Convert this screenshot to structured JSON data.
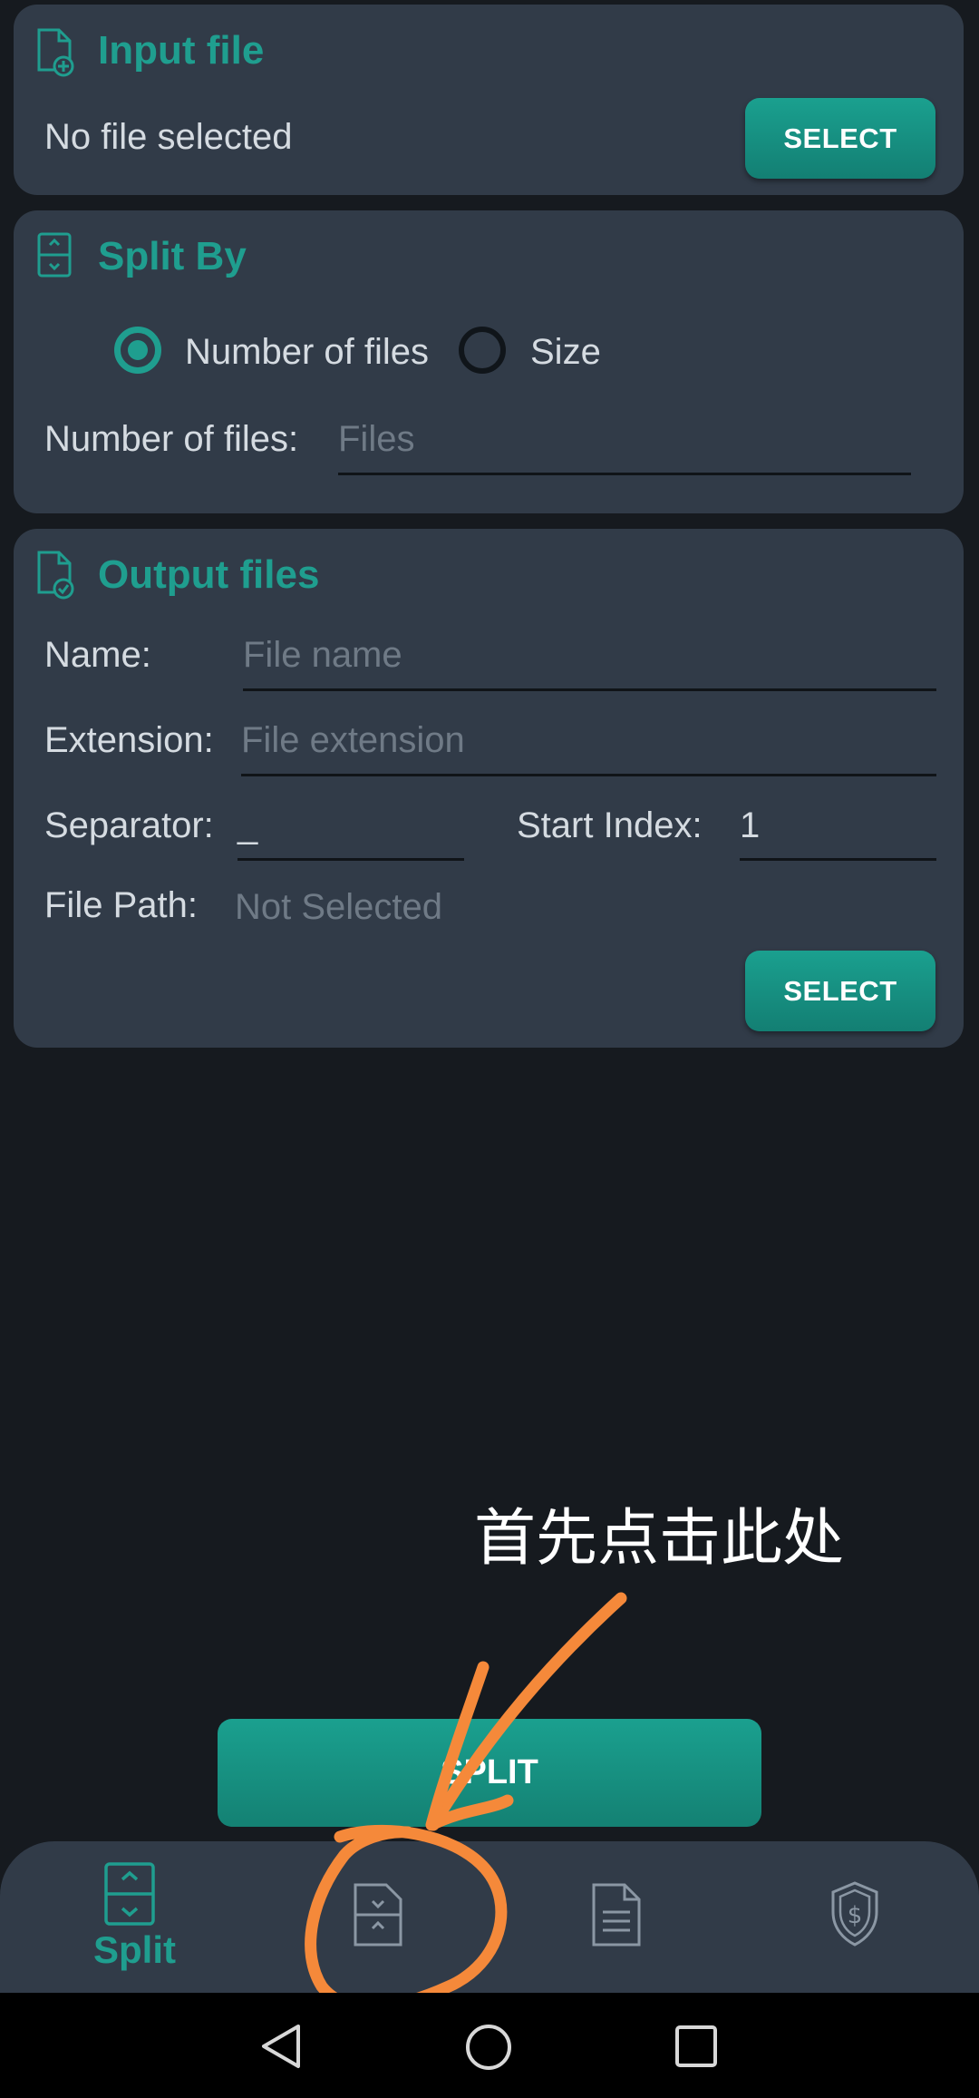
{
  "input_card": {
    "title": "Input file",
    "status": "No file selected",
    "select_label": "SELECT"
  },
  "split_card": {
    "title": "Split By",
    "options": [
      "Number of files",
      "Size"
    ],
    "selected": "Number of files",
    "number_label": "Number of files:",
    "number_placeholder": "Files"
  },
  "output_card": {
    "title": "Output files",
    "name_label": "Name:",
    "name_placeholder": "File name",
    "ext_label": "Extension:",
    "ext_placeholder": "File extension",
    "sep_label": "Separator:",
    "sep_value": "_",
    "start_label": "Start Index:",
    "start_value": "1",
    "path_label": "File Path:",
    "path_value": "Not Selected",
    "select_label": "SELECT"
  },
  "split_button": "SPLIT",
  "bottom_nav": {
    "items": [
      {
        "label": "Split",
        "icon": "split-file-icon",
        "active": true
      },
      {
        "label": "",
        "icon": "merge-file-icon",
        "active": false
      },
      {
        "label": "",
        "icon": "document-icon",
        "active": false
      },
      {
        "label": "",
        "icon": "shield-dollar-icon",
        "active": false
      }
    ]
  },
  "annotation": {
    "text": "首先点击此处",
    "color": "#f5893a"
  },
  "colors": {
    "accent": "#1f9e8f",
    "card": "#313b48",
    "background": "#161a1f"
  }
}
